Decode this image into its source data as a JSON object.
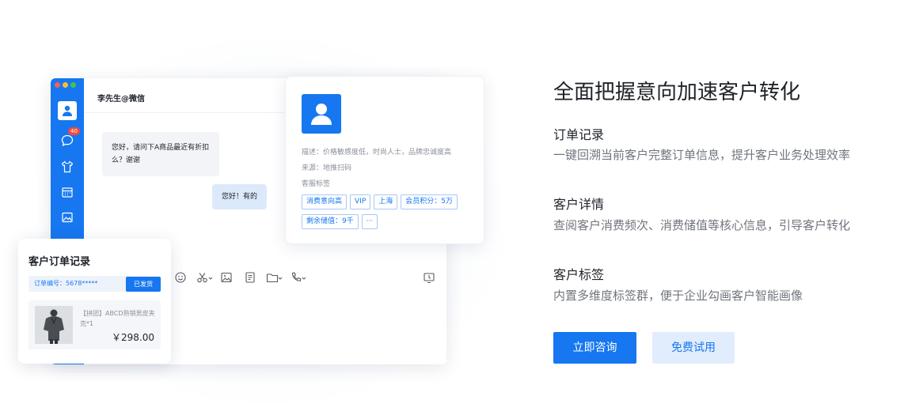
{
  "chat": {
    "contact_name": "李先生@微信",
    "unread_count": "40",
    "incoming_message": "您好，请问下A商品最近有折扣么？谢谢",
    "outgoing_message": "您好！有的"
  },
  "profile": {
    "description": "描述：价格敏感度低，时尚人士，品牌忠诚度高",
    "source": "来源：地推扫码",
    "tags_label": "客服标签",
    "tags": [
      "消费意向高",
      "VIP",
      "上海",
      "会员积分：5万",
      "剩余储值：9千",
      "···"
    ]
  },
  "order": {
    "title": "客户订单记录",
    "order_number": "订单编号：5678*****",
    "status_button": "已发货",
    "product_name": "【拼团】ABCD熟销男皮夹克*1",
    "price": "￥298.00"
  },
  "marketing": {
    "headline": "全面把握意向加速客户转化",
    "features": [
      {
        "title": "订单记录",
        "desc": "一键回溯当前客户完整订单信息，提升客户业务处理效率"
      },
      {
        "title": "客户详情",
        "desc": "查阅客户消费频次、消费储值等核心信息，引导客户转化"
      },
      {
        "title": "客户标签",
        "desc": "内置多维度标签群，便于企业勾画客户智能画像"
      }
    ],
    "primary_button": "立即咨询",
    "secondary_button": "免费试用"
  },
  "colors": {
    "brand": "#1677f0",
    "brand_light": "#e1edfd",
    "badge": "#f5493d"
  }
}
